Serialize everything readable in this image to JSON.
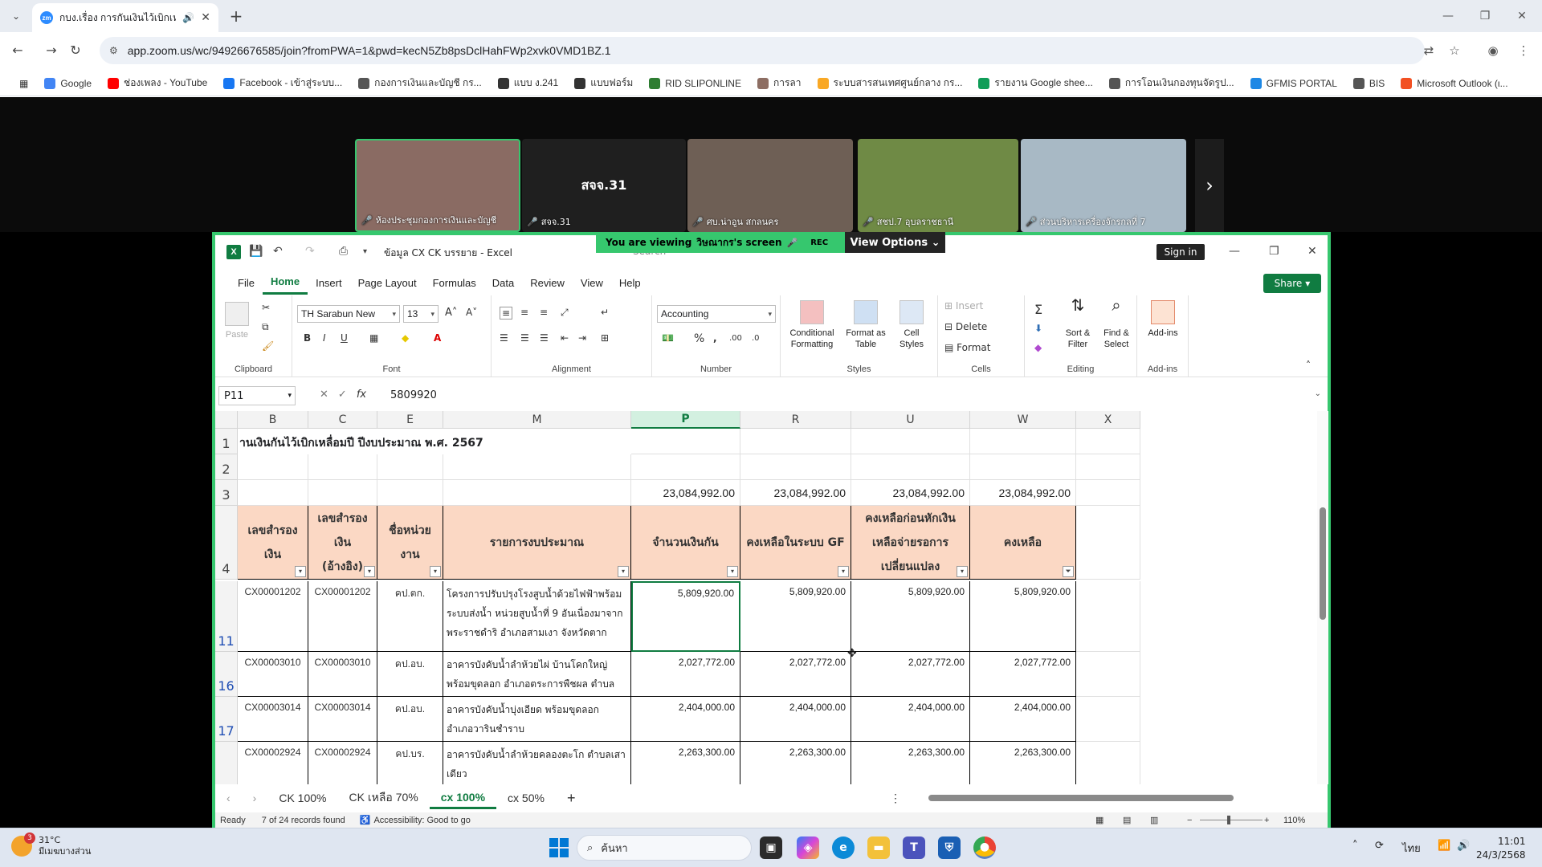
{
  "browser": {
    "tab_title": "กบง.เรื่อง การกันเงินไว้เบิกเหลื่อ",
    "tab_favicon": "zm",
    "url": "app.zoom.us/wc/94926676585/join?fromPWA=1&pwd=kecN5Zb8psDclHahFWp2xvk0VMD1BZ.1",
    "bookmarks": [
      {
        "label": "Google",
        "color": "#4285f4"
      },
      {
        "label": "ช่องเพลง - YouTube",
        "color": "#ff0000"
      },
      {
        "label": "Facebook - เข้าสู่ระบบ...",
        "color": "#1877f2"
      },
      {
        "label": "กองการเงินและบัญชี กร...",
        "color": "#555555"
      },
      {
        "label": "แบบ ง.241",
        "color": "#333333"
      },
      {
        "label": "แบบฟอร์ม",
        "color": "#333333"
      },
      {
        "label": "RID SLIPONLINE",
        "color": "#2e7d32"
      },
      {
        "label": "การลา",
        "color": "#8d6e63"
      },
      {
        "label": "ระบบสารสนเทศศูนย์กลาง กร...",
        "color": "#f9a825"
      },
      {
        "label": "รายงาน Google shee...",
        "color": "#0f9d58"
      },
      {
        "label": "การโอนเงินกองทุนจัดรูป...",
        "color": "#555555"
      },
      {
        "label": "GFMIS PORTAL",
        "color": "#1e88e5"
      },
      {
        "label": "BIS",
        "color": "#555555"
      },
      {
        "label": "Microsoft Outlook (ι...",
        "color": "#f25022"
      }
    ]
  },
  "zoom": {
    "participants": [
      {
        "name": "ห้องประชุมกองการเงินและบัญชี",
        "bg": "#8a6b63"
      },
      {
        "name": "สจจ.31",
        "bg": "#1f1f1f",
        "center_label": "สจจ.31"
      },
      {
        "name": "ศบ.น่าอูน สกลนคร",
        "bg": "#6e5f55"
      },
      {
        "name": "สชป.7 อุบลราชธานี",
        "bg": "#6f8a45"
      },
      {
        "name": "ส่วนบริหารเครื่องจักรกลที่ 7",
        "bg": "#a8b9c5"
      }
    ],
    "viewing_prefix": "You are viewing",
    "viewing_name": "วิษณากร's screen",
    "rec_label": "REC",
    "view_options": "View Options"
  },
  "excel": {
    "doc_title": "ข้อมูล CX CK บรรยาย  -  Excel",
    "search_placeholder": "Search",
    "sign_in": "Sign in",
    "share": "Share",
    "menu": [
      "File",
      "Home",
      "Insert",
      "Page Layout",
      "Formulas",
      "Data",
      "Review",
      "View",
      "Help"
    ],
    "ribbon": {
      "clipboard": "Clipboard",
      "paste": "Paste",
      "font": "Font",
      "font_name": "TH Sarabun New",
      "font_size": "13",
      "alignment": "Alignment",
      "number": "Number",
      "number_format": "Accounting",
      "styles": "Styles",
      "cond_format": "Conditional Formatting",
      "format_table": "Format as Table",
      "cell_styles": "Cell Styles",
      "cells": "Cells",
      "insert": "Insert",
      "delete": "Delete",
      "format": "Format",
      "editing": "Editing",
      "sort_filter": "Sort & Filter",
      "find_select": "Find & Select",
      "addins_group": "Add-ins",
      "addins": "Add-ins"
    },
    "name_box": "P11",
    "formula": "5809920",
    "columns": [
      "B",
      "C",
      "E",
      "M",
      "P",
      "R",
      "U",
      "W",
      "X"
    ],
    "sheet_title": "านเงินกันไว้เบิกเหลื่อมปี ปีงบประมาณ พ.ศ. 2567",
    "totals": [
      "23,084,992.00",
      "23,084,992.00",
      "23,084,992.00",
      "23,084,992.00"
    ],
    "headers": [
      "เลขสำรองเงิน",
      "เลขสำรองเงิน (อ้างอิง)",
      "ชื่อหน่วยงาน",
      "รายการงบประมาณ",
      "จำนวนเงินกัน",
      "คงเหลือในระบบ GF",
      "คงเหลือก่อนหักเงินเหลือจ่ายรอการเปลี่ยนแปลง",
      "คงเหลือ"
    ],
    "rows": [
      {
        "num": "11",
        "b": "CX00001202",
        "c": "CX00001202",
        "e": "คป.ตก.",
        "m": "โครงการปรับปรุงโรงสูบน้ำด้วยไฟฟ้าพร้อมระบบส่งน้ำ หน่วยสูบน้ำที่ 9 อันเนื่องมาจากพระราชดำริ อำเภอสามเงา จังหวัดตาก",
        "p": "5,809,920.00",
        "r": "5,809,920.00",
        "u": "5,809,920.00",
        "w": "5,809,920.00"
      },
      {
        "num": "16",
        "b": "CX00003010",
        "c": "CX00003010",
        "e": "คป.อบ.",
        "m": "อาคารบังคับน้ำลำห้วยไผ่ บ้านโคกใหญ่ พร้อมขุดลอก อำเภอตระการพืชผล ตำบลโคกจาน จังหวัดอุบลราชธานี",
        "p": "2,027,772.00",
        "r": "2,027,772.00",
        "u": "2,027,772.00",
        "w": "2,027,772.00"
      },
      {
        "num": "17",
        "b": "CX00003014",
        "c": "CX00003014",
        "e": "คป.อบ.",
        "m": "อาคารบังคับน้ำบุ่งเอียด พร้อมขุดลอก อำเภอวารินชำราบ",
        "p": "2,404,000.00",
        "r": "2,404,000.00",
        "u": "2,404,000.00",
        "w": "2,404,000.00"
      },
      {
        "num": "",
        "b": "CX00002924",
        "c": "CX00002924",
        "e": "คป.บร.",
        "m": "อาคารบังคับน้ำลำห้วยคลองตะโก ตำบลเสาเดียว",
        "p": "2,263,300.00",
        "r": "2,263,300.00",
        "u": "2,263,300.00",
        "w": "2,263,300.00"
      }
    ],
    "sheet_tabs": [
      "CK 100%",
      "CK เหลือ 70%",
      "cx 100%",
      "cx 50%"
    ],
    "active_sheet": "cx 100%",
    "status_ready": "Ready",
    "status_records": "7 of 24 records found",
    "status_access": "Accessibility: Good to go",
    "zoom_level": "110%"
  },
  "taskbar": {
    "temp": "31°C",
    "weather": "มีเมฆบางส่วน",
    "notif": "3",
    "search": "ค้นหา",
    "lang": "ไทย",
    "time": "11:01",
    "date": "24/3/2568"
  }
}
